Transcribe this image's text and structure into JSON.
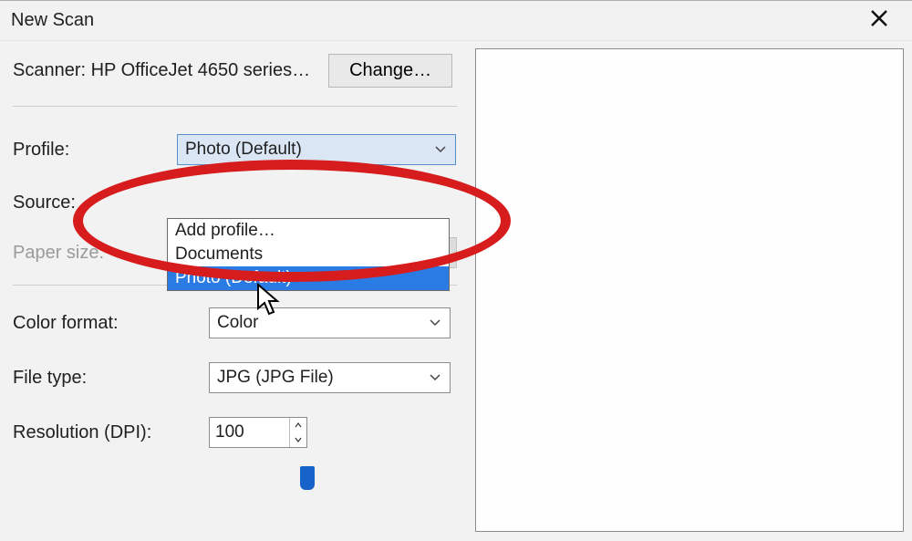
{
  "title": "New Scan",
  "scanner": {
    "label_prefix": "Scanner: ",
    "name": "HP OfficeJet 4650 series…",
    "change_label": "Change…"
  },
  "profile": {
    "label": "Profile:",
    "selected": "Photo (Default)",
    "options": {
      "add": "Add profile…",
      "documents": "Documents",
      "photo_default": "Photo (Default)"
    }
  },
  "source": {
    "label": "Source:"
  },
  "paper_size": {
    "label": "Paper size:"
  },
  "color_format": {
    "label": "Color format:",
    "value": "Color"
  },
  "file_type": {
    "label": "File type:",
    "value": "JPG (JPG File)"
  },
  "resolution": {
    "label": "Resolution (DPI):",
    "value": "100"
  }
}
